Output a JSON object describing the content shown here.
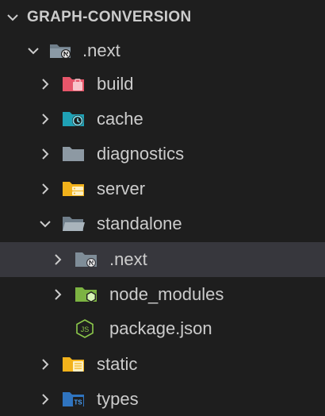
{
  "explorer": {
    "section_title": "GRAPH-CONVERSION",
    "items": [
      {
        "label": ".next",
        "icon": "nextjs-folder-open-icon",
        "expanded": true
      },
      {
        "label": "build",
        "icon": "build-folder-icon",
        "expanded": false
      },
      {
        "label": "cache",
        "icon": "cache-folder-icon",
        "expanded": false
      },
      {
        "label": "diagnostics",
        "icon": "folder-icon",
        "expanded": false
      },
      {
        "label": "server",
        "icon": "server-folder-icon",
        "expanded": false
      },
      {
        "label": "standalone",
        "icon": "folder-open-icon",
        "expanded": true
      },
      {
        "label": ".next",
        "icon": "nextjs-folder-icon",
        "expanded": false,
        "selected": true
      },
      {
        "label": "node_modules",
        "icon": "node-modules-folder-icon",
        "expanded": false
      },
      {
        "label": "package.json",
        "icon": "nodejs-file-icon"
      },
      {
        "label": "static",
        "icon": "static-folder-icon",
        "expanded": false
      },
      {
        "label": "types",
        "icon": "typescript-folder-icon",
        "expanded": false
      }
    ]
  },
  "colors": {
    "background": "#1e1e1e",
    "selected_row": "#37373d",
    "text": "#cccccc"
  }
}
